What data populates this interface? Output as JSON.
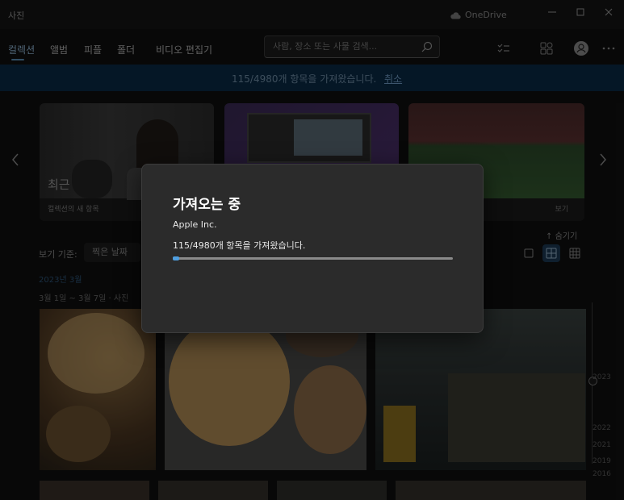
{
  "window": {
    "title": "사진",
    "cloud_label": "OneDrive",
    "controls": [
      "minimize",
      "maximize",
      "close"
    ]
  },
  "nav": {
    "tabs": [
      {
        "label": "컬렉션",
        "active": true
      },
      {
        "label": "앨범",
        "active": false
      },
      {
        "label": "피플",
        "active": false
      },
      {
        "label": "폴더",
        "active": false
      },
      {
        "label": "비디오 편집기",
        "active": false
      }
    ],
    "search_placeholder": "사람, 장소 또는 사물 검색...",
    "icons": [
      "select-icon",
      "more-apps-icon",
      "account-icon",
      "more-icon"
    ]
  },
  "banner": {
    "text": "115/4980개 항목을 가져왔습니다.",
    "cancel_label": "취소",
    "color": "#0a2a45"
  },
  "cards": [
    {
      "overlay_label": "최근",
      "caption": "컬렉션의 새 항목"
    },
    {
      "overlay_label": "",
      "caption": ""
    },
    {
      "overlay_label": "",
      "caption": "보기"
    }
  ],
  "view": {
    "label": "보기 기준:",
    "selected": "찍은 날짜",
    "hide_label": "숨기기",
    "month": "2023년 3월",
    "date_range": "3월 1일 ~ 3월 7일 · 사진"
  },
  "timeline": {
    "years": [
      "2023",
      "2022",
      "2021",
      "2019",
      "2016"
    ]
  },
  "dialog": {
    "title": "가져오는 중",
    "source": "Apple Inc.",
    "status": "115/4980개 항목을 가져왔습니다.",
    "progress": 0.023,
    "accent": "#4f9fe0"
  }
}
